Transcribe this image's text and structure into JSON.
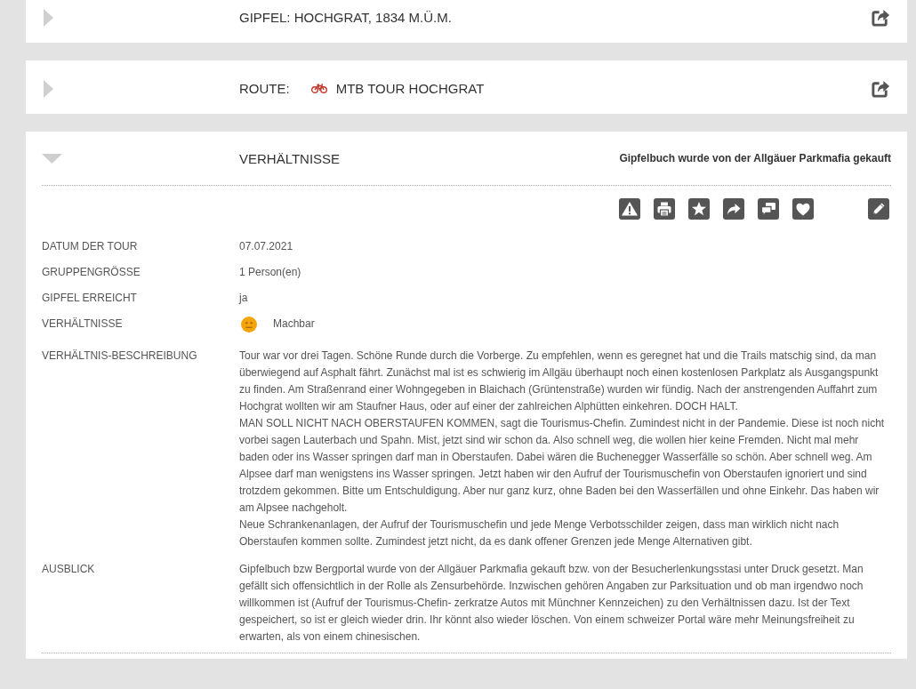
{
  "sections": [
    {
      "kind": "summit",
      "expanded": false,
      "title": "GIPFEL: HOCHGRAT, 1834 M.Ü.M."
    },
    {
      "kind": "route",
      "expanded": false,
      "label": "ROUTE:",
      "title": "MTB TOUR HOCHGRAT"
    },
    {
      "kind": "details",
      "expanded": true,
      "title": "VERHÄLTNISSE",
      "note": "Gipfelbuch wurde von der Allgäuer Parkmafia gekauft",
      "fields": [
        {
          "kind": "text",
          "label": "DATUM DER TOUR",
          "value": "07.07.2021"
        },
        {
          "kind": "text",
          "label": "GRUPPENGRÖSSE",
          "value": "1 Person(en)"
        },
        {
          "kind": "text",
          "label": "GIPFEL ERREICHT",
          "value": "ja"
        },
        {
          "kind": "rating",
          "label": "VERHÄLTNISSE",
          "value": "Machbar"
        },
        {
          "kind": "paragraphs",
          "label": "VERHÄLTNIS-BESCHREIBUNG",
          "paragraphs": [
            "Tour war vor drei Tagen. Schöne Runde durch die Vorberge. Zu empfehlen, wenn es geregnet hat und die Trails matschig sind, da man überwiegend auf Asphalt fährt. Zunächst mal ist es schwierig im Allgäu überhaupt noch einen kostenlosen Parkplatz als Ausgangspunkt zu finden. Am Straßenrand einer Wohngegeben in Blaichach (Grüntenstraße) wurden wir fündig. Nach der anstrengenden Auffahrt zum Hochgrat wollten wir am Staufner Haus, oder auf einer der zahlreichen Alphütten einkehren. DOCH HALT.",
            "MAN SOLL NICHT NACH OBERSTAUFEN KOMMEN, sagt die Tourismus-Chefin. Zumindest nicht in der Pandemie. Diese ist noch nicht vorbei sagen Lauterbach und Spahn. Mist, jetzt sind wir schon da. Also schnell weg, die wollen hier keine Fremden. Nicht mal mehr baden oder ins Wasser springen darf man in Oberstaufen. Dabei wären die Buchenegger Wasserfälle so schön. Aber schnell weg. Am Alpsee darf man wenigstens ins Wasser springen. Jetzt haben wir den Aufruf der Tourismuschefin von Oberstaufen ignoriert und sind trotzdem gekommen. Bitte um Entschuldigung. Aber nur ganz kurz, ohne Baden bei den Wasserfällen und ohne Einkehr. Das haben wir am Alpsee nachgeholt.",
            "Neue Schrankenanlagen, der Aufruf der Tourismuschefin und jede Menge Verbotsschilder zeigen, dass man wirklich nicht nach Oberstaufen kommen sollte. Zumindest jetzt nicht, da es dank offener Grenzen jede Menge Alternativen gibt."
          ]
        },
        {
          "kind": "paragraphs",
          "label": "AUSBLICK",
          "paragraphs": [
            "Gipfelbuch bzw Bergportal wurde von der Allgäuer Parkmafia gekauft bzw. von der Besucherlenkungsstasi unter Druck gesetzt. Man gefällt sich offensichtlich in der Rolle als Zensurbehörde. Inzwischen gehören Angaben zur Parksituation und ob man irgendwo noch willkommen ist (Aufruf der Tourismus-Chefin- zerkratze Autos mit Münchner Kennzeichen) zu den Verhältnissen dazu. Ist der Text gespeichert, so ist er gleich wieder drin. Ihr könnt also wieder löschen. Von einem schweizer Portal wäre mehr Meinungsfreiheit zu erwarten, als von einem chinesischen."
          ]
        }
      ]
    }
  ]
}
